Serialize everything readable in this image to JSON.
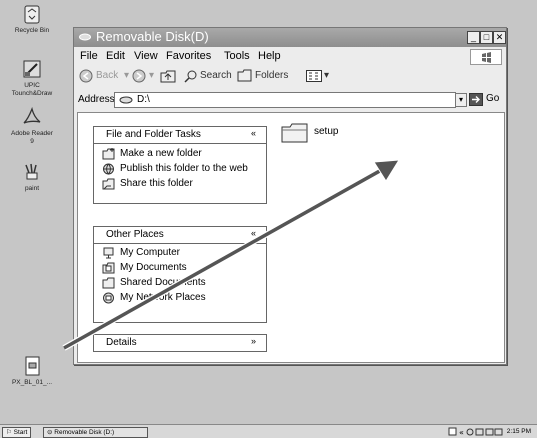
{
  "desktop": {
    "icons": [
      {
        "label": "Recycle Bin",
        "icon": "recycle-bin-icon"
      },
      {
        "label": "UPIC\nTounch&Draw",
        "icon": "drawing-app-icon"
      },
      {
        "label": "Adobe Reader\n9",
        "icon": "adobe-reader-icon"
      },
      {
        "label": "paint",
        "icon": "paint-icon"
      },
      {
        "label": "PX_BL_01_...",
        "icon": "file-icon"
      }
    ]
  },
  "window": {
    "title": "Removable Disk(D)",
    "menu": [
      "File",
      "Edit",
      "View",
      "Favorites",
      "Tools",
      "Help"
    ],
    "toolbar": {
      "back": "Back",
      "search": "Search",
      "folders": "Folders"
    },
    "address": {
      "label": "Address",
      "value": "D:\\",
      "go": "Go"
    },
    "tasks_panel": {
      "title": "File and Folder Tasks",
      "items": [
        "Make a new folder",
        "Publish this folder to the web",
        "Share this folder"
      ]
    },
    "places_panel": {
      "title": "Other Places",
      "items": [
        "My Computer",
        "My Documents",
        "Shared Documents",
        "My Network Places"
      ]
    },
    "details_panel": {
      "title": "Details"
    },
    "folder": {
      "name": "setup"
    }
  },
  "taskbar": {
    "start": "Start",
    "task": "Removable Disk (D:)",
    "clock": "2:15 PM"
  }
}
